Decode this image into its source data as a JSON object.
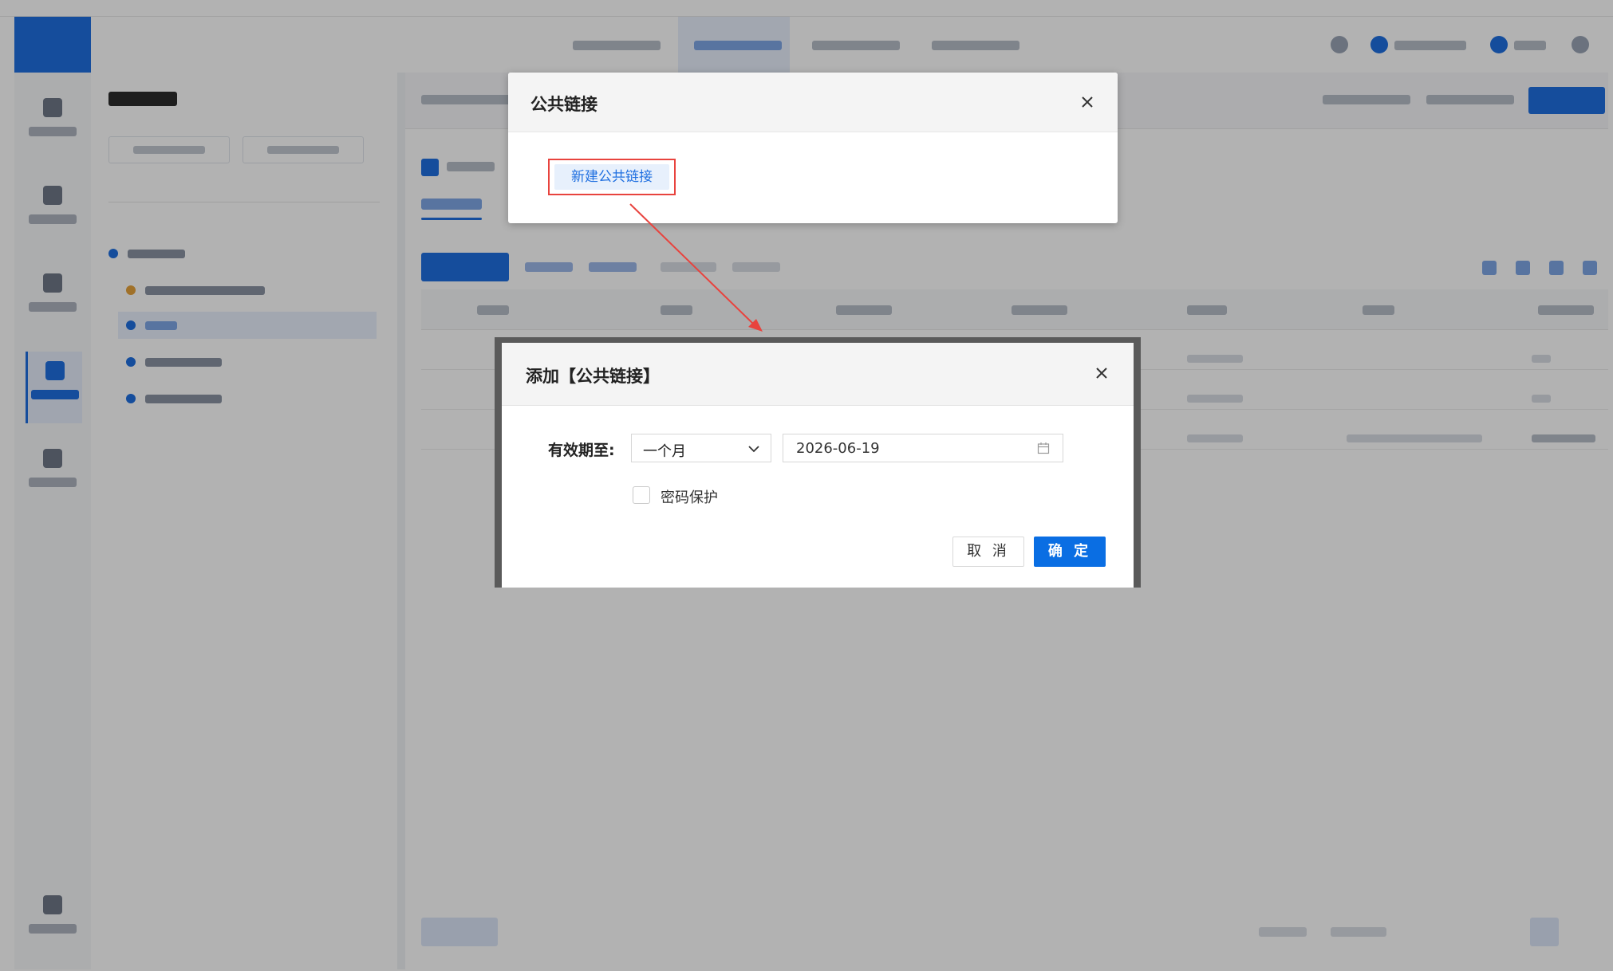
{
  "dialog_public_link": {
    "title": "公共链接",
    "close_icon": "close-icon",
    "new_link_button": "新建公共链接"
  },
  "dialog_add_public_link": {
    "title": "添加【公共链接】",
    "close_icon": "close-icon",
    "validity_label": "有效期至:",
    "validity_period_value": "一个月",
    "expiry_date_value": "2026-06-19",
    "password_protect_label": "密码保护",
    "password_protect_checked": false,
    "cancel_button": "取 消",
    "confirm_button": "确 定"
  },
  "colors": {
    "primary": "#0a6ee3",
    "highlight_box": "#e8433e",
    "annotation_arrow": "#e8433e",
    "overlay": "rgba(0,0,0,0.30)"
  }
}
